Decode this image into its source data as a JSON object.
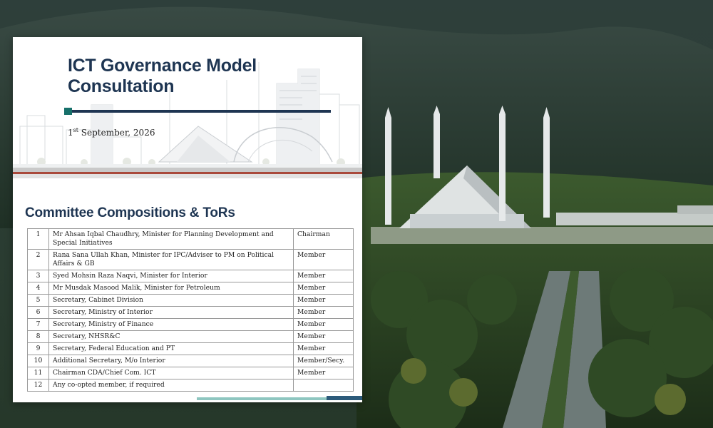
{
  "document": {
    "title": "ICT Governance Model Consultation",
    "date_day": "1",
    "date_suffix": "st",
    "date_rest": " September, 2026",
    "section_title": "Committee Compositions & ToRs",
    "members": [
      {
        "num": "1",
        "name": "Mr Ahsan Iqbal Chaudhry, Minister for Planning Development and Special Initiatives",
        "role": "Chairman"
      },
      {
        "num": "2",
        "name": "Rana Sana Ullah Khan, Minister for IPC/Adviser to PM on Political Affairs & GB",
        "role": "Member"
      },
      {
        "num": "3",
        "name": "Syed Mohsin Raza Naqvi, Minister for Interior",
        "role": "Member"
      },
      {
        "num": "4",
        "name": "Mr Musdak Masood Malik, Minister for Petroleum",
        "role": "Member"
      },
      {
        "num": "5",
        "name": "Secretary, Cabinet Division",
        "role": "Member"
      },
      {
        "num": "6",
        "name": "Secretary, Ministry of Interior",
        "role": "Member"
      },
      {
        "num": "7",
        "name": "Secretary, Ministry of Finance",
        "role": "Member"
      },
      {
        "num": "8",
        "name": "Secretary, NHSR&C",
        "role": "Member"
      },
      {
        "num": "9",
        "name": "Secretary, Federal Education and PT",
        "role": "Member"
      },
      {
        "num": "10",
        "name": "Additional Secretary, M/o Interior",
        "role": "Member/Secy."
      },
      {
        "num": "11",
        "name": "Chairman CDA/Chief Com. ICT",
        "role": "Member"
      },
      {
        "num": "12",
        "name": "Any co-opted member, if required",
        "role": ""
      }
    ]
  },
  "colors": {
    "title_navy": "#1e3552",
    "accent_teal": "#16706a",
    "band_red": "#a9493b"
  }
}
